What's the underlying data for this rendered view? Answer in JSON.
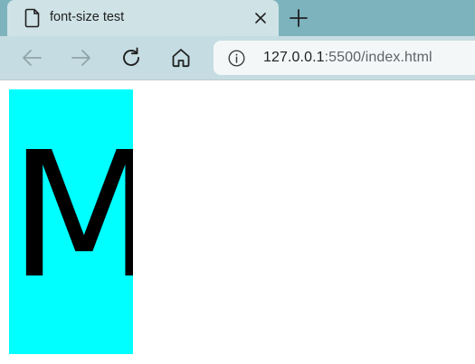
{
  "tab": {
    "title": "font-size test",
    "icon": "document-icon",
    "close_icon": "close-icon"
  },
  "toolbar": {
    "new_tab_icon": "plus-icon",
    "back_icon": "arrow-left-icon",
    "forward_icon": "arrow-right-icon",
    "reload_icon": "reload-icon",
    "home_icon": "home-icon"
  },
  "address_bar": {
    "info_icon": "info-icon",
    "url_host": "127.0.0.1",
    "url_rest": ":5500/index.html"
  },
  "page": {
    "letter": "M",
    "box_color": "#00ffff",
    "text_color": "#000000"
  },
  "colors": {
    "tabstrip": "#7db3bd",
    "active_tab": "#cfe3e7",
    "toolbar": "#c5dde2",
    "omnibox": "#f4f7f8"
  }
}
